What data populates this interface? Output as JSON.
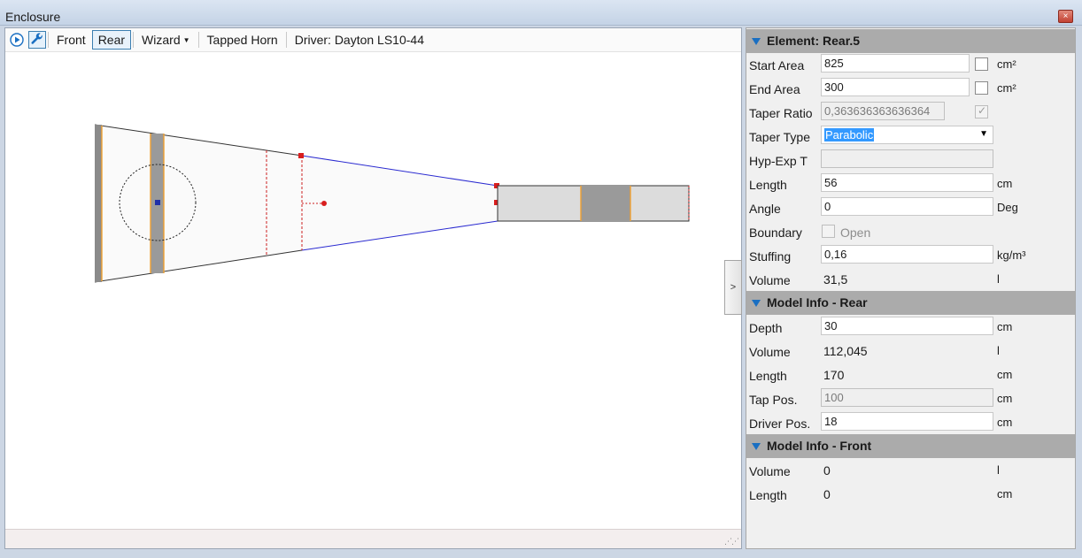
{
  "window": {
    "title": "Enclosure",
    "close_glyph": "×"
  },
  "toolbar": {
    "icons": [
      "play-icon",
      "wrench-icon"
    ],
    "front_label": "Front",
    "rear_label": "Rear",
    "wizard_label": "Wizard",
    "tapped_horn_label": "Tapped Horn",
    "driver_label": "Driver: Dayton LS10-44"
  },
  "collapse_button": {
    "label": ">"
  },
  "element_section": {
    "header": "Element: Rear.5",
    "start_area": {
      "label": "Start Area",
      "value": "825",
      "unit": "cm²"
    },
    "end_area": {
      "label": "End Area",
      "value": "300",
      "unit": "cm²"
    },
    "taper_ratio": {
      "label": "Taper Ratio",
      "value": "0,363636363636364"
    },
    "taper_type": {
      "label": "Taper Type",
      "value": "Parabolic"
    },
    "hyp_exp_t": {
      "label": "Hyp-Exp T",
      "value": ""
    },
    "length": {
      "label": "Length",
      "value": "56",
      "unit": "cm"
    },
    "angle": {
      "label": "Angle",
      "value": "0",
      "unit": "Deg"
    },
    "boundary": {
      "label": "Boundary",
      "option": "Open"
    },
    "stuffing": {
      "label": "Stuffing",
      "value": "0,16",
      "unit": "kg/m³"
    },
    "volume": {
      "label": "Volume",
      "value": "31,5",
      "unit": "l"
    }
  },
  "model_rear": {
    "header": "Model Info - Rear",
    "depth": {
      "label": "Depth",
      "value": "30",
      "unit": "cm"
    },
    "volume": {
      "label": "Volume",
      "value": "112,045",
      "unit": "l"
    },
    "length": {
      "label": "Length",
      "value": "170",
      "unit": "cm"
    },
    "tap_pos": {
      "label": "Tap Pos.",
      "value": "100",
      "unit": "cm"
    },
    "driver_pos": {
      "label": "Driver Pos.",
      "value": "18",
      "unit": "cm"
    }
  },
  "model_front": {
    "header": "Model Info - Front",
    "volume": {
      "label": "Volume",
      "value": "0",
      "unit": "l"
    },
    "length": {
      "label": "Length",
      "value": "0",
      "unit": "cm"
    }
  },
  "colors": {
    "accent": "#1a6fc2",
    "section_header": "#ababab",
    "outline_blue": "#2a2ad0",
    "marker_red": "#d81e1e",
    "orange_line": "#f0a030"
  }
}
